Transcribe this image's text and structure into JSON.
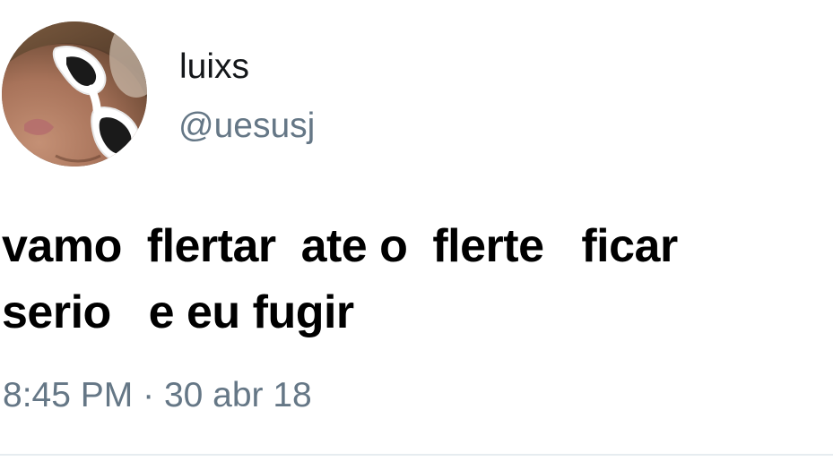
{
  "tweet": {
    "author": {
      "display_name": "luixs",
      "handle": "@uesusj",
      "avatar_icon": "profile-photo-with-white-sunglasses"
    },
    "text_lines": [
      [
        "vamo",
        "flertar",
        "ate o",
        "flerte",
        "ficar"
      ],
      [
        "serio",
        "e eu fugir"
      ]
    ],
    "timestamp": {
      "time": "8:45 PM",
      "separator": "·",
      "date": "30 abr 18"
    }
  },
  "colors": {
    "text_primary": "#14171a",
    "text_secondary": "#657786",
    "tweet_text": "#000000",
    "background": "#ffffff",
    "divider": "#e6ecf0"
  }
}
